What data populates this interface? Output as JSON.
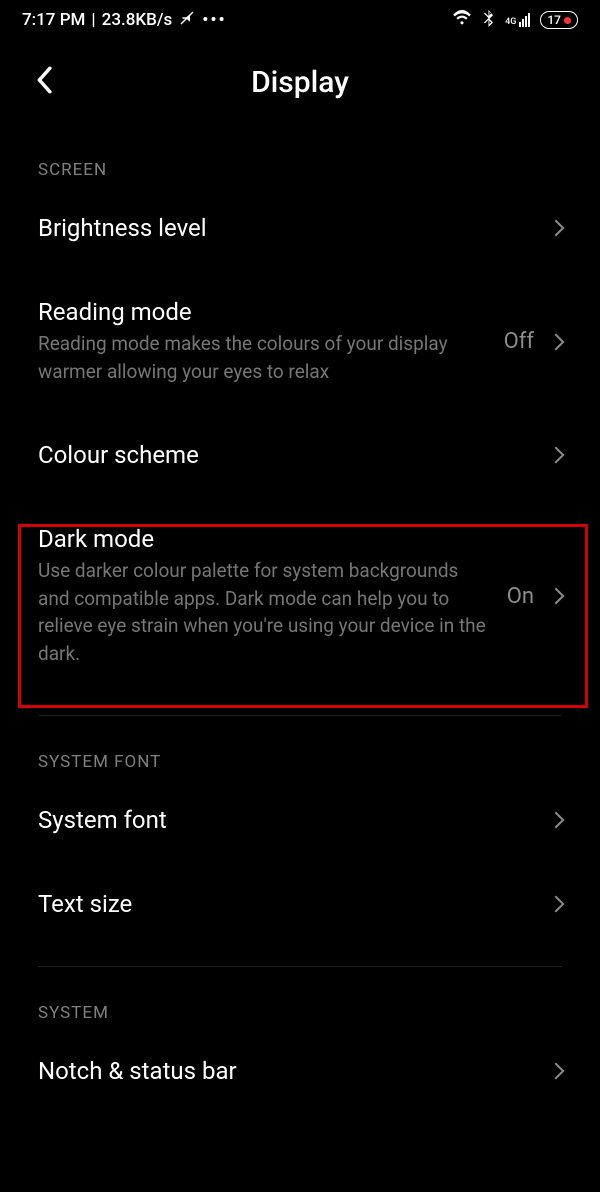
{
  "statusbar": {
    "time": "7:17 PM",
    "speed": "23.8KB/s",
    "battery": "17",
    "network": "4G"
  },
  "header": {
    "title": "Display"
  },
  "sections": {
    "screen": {
      "label": "SCREEN",
      "brightness": {
        "title": "Brightness level"
      },
      "reading": {
        "title": "Reading mode",
        "sub": "Reading mode makes the colours of your display warmer allowing your eyes to relax",
        "value": "Off"
      },
      "colour": {
        "title": "Colour scheme"
      },
      "dark": {
        "title": "Dark mode",
        "sub": "Use darker colour palette for system backgrounds and compatible apps. Dark mode can help you to relieve eye strain when you're using your device in the dark.",
        "value": "On"
      }
    },
    "systemfont": {
      "label": "SYSTEM FONT",
      "font": {
        "title": "System font"
      },
      "text": {
        "title": "Text size"
      }
    },
    "system": {
      "label": "SYSTEM",
      "notch": {
        "title": "Notch & status bar"
      }
    }
  },
  "highlight": {
    "target": "dark-mode"
  }
}
